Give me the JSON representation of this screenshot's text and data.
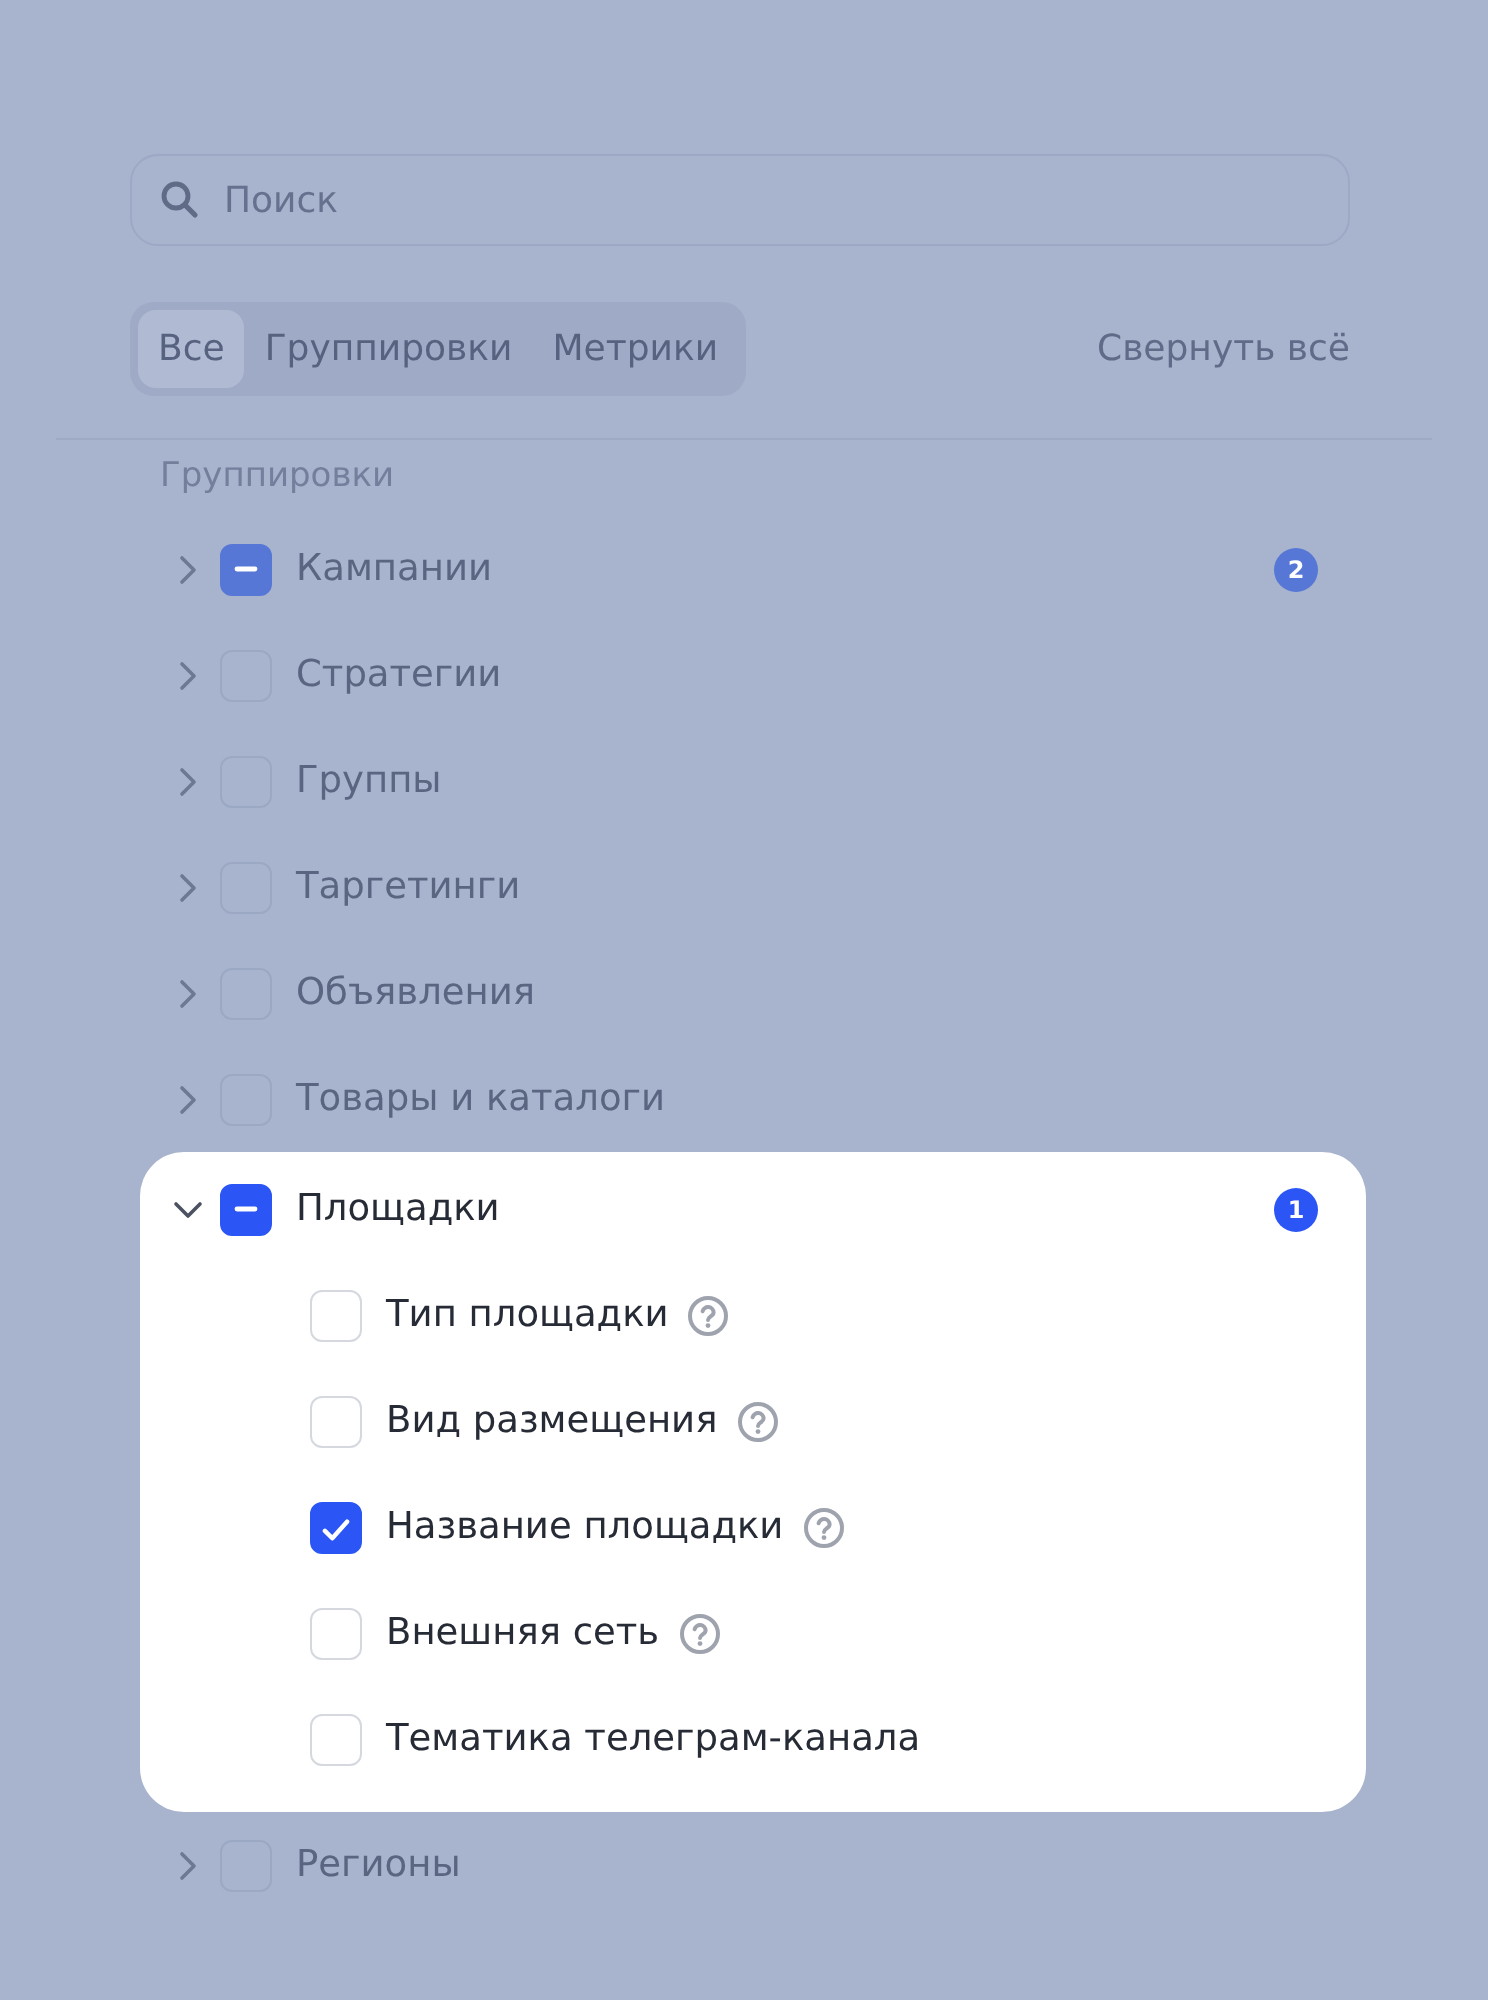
{
  "search": {
    "placeholder": "Поиск"
  },
  "tabs": [
    {
      "label": "Все",
      "selected": true
    },
    {
      "label": "Группировки",
      "selected": false
    },
    {
      "label": "Метрики",
      "selected": false
    }
  ],
  "collapse_all": "Свернуть всё",
  "section_title": "Группировки",
  "groups": [
    {
      "label": "Кампании",
      "indeterminate": true,
      "expanded": false,
      "highlighted": false,
      "badge": "2"
    },
    {
      "label": "Стратегии",
      "checked": false,
      "indeterminate": false,
      "expanded": false,
      "highlighted": false
    },
    {
      "label": "Группы",
      "checked": false,
      "indeterminate": false,
      "expanded": false,
      "highlighted": false
    },
    {
      "label": "Таргетинги",
      "checked": false,
      "indeterminate": false,
      "expanded": false,
      "highlighted": false
    },
    {
      "label": "Объявления",
      "checked": false,
      "indeterminate": false,
      "expanded": false,
      "highlighted": false
    },
    {
      "label": "Товары и каталоги",
      "checked": false,
      "indeterminate": false,
      "expanded": false,
      "highlighted": false
    },
    {
      "label": "Площадки",
      "indeterminate": true,
      "expanded": true,
      "highlighted": true,
      "badge": "1",
      "children": [
        {
          "label": "Тип площадки",
          "checked": false,
          "help": true
        },
        {
          "label": "Вид размещения",
          "checked": false,
          "help": true
        },
        {
          "label": "Название площадки",
          "checked": true,
          "help": true
        },
        {
          "label": "Внешняя сеть",
          "checked": false,
          "help": true
        },
        {
          "label": "Тематика телеграм-канала",
          "checked": false,
          "help": false
        }
      ]
    },
    {
      "label": "Регионы",
      "checked": false,
      "indeterminate": false,
      "expanded": false,
      "highlighted": false
    }
  ]
}
